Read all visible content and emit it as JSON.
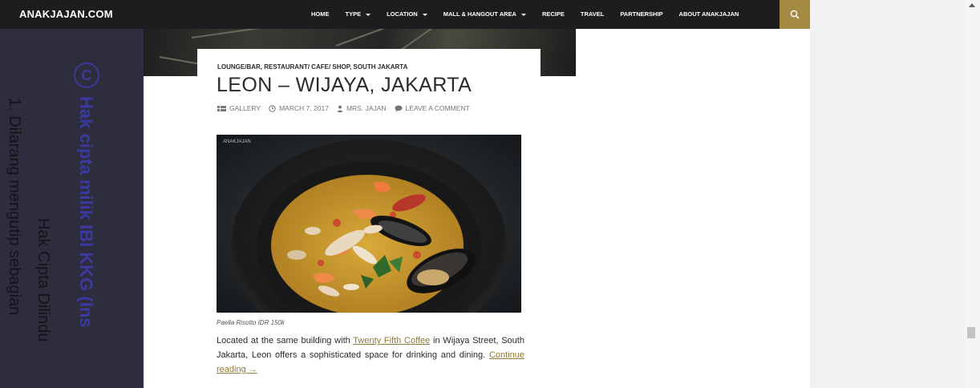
{
  "header": {
    "site_title": "ANAKJAJAN.COM",
    "nav": [
      {
        "label": "HOME",
        "has_caret": false
      },
      {
        "label": "TYPE",
        "has_caret": true
      },
      {
        "label": "LOCATION",
        "has_caret": true
      },
      {
        "label": "MALL & HANGOUT AREA",
        "has_caret": true
      },
      {
        "label": "RECIPE",
        "has_caret": false
      },
      {
        "label": "TRAVEL",
        "has_caret": false
      },
      {
        "label": "PARTNERSHIP",
        "has_caret": false
      },
      {
        "label": "ABOUT ANAKJAJAN",
        "has_caret": false
      }
    ],
    "search_icon": "search-icon"
  },
  "watermark": {
    "symbol": "C",
    "line1": "Hak cipta milik IBI KKG (Ins",
    "line2": "Hak Cipta Dilindu",
    "line3": "1. Dilarang mengutip sebagian"
  },
  "post": {
    "categories": "LOUNGE/BAR, RESTAURANT/ CAFE/ SHOP, SOUTH JAKARTA",
    "title": "LEON – WIJAYA, JAKARTA",
    "meta": {
      "format": "GALLERY",
      "date": "MARCH 7, 2017",
      "author": "MRS. JAJAN",
      "comments": "LEAVE A COMMENT"
    },
    "image_watermark": "ANAKJAJAN",
    "caption": "Paella Risotto IDR 150k",
    "excerpt": {
      "part1": "Located at the same building with ",
      "link": "Twenty Fifth Coffee",
      "part2": " in Wijaya Street, South Jakarta, Leon offers a sophisticated space for drinking and dining. ",
      "continue": "Continue reading →"
    }
  },
  "colors": {
    "navbar": "#1d1d1f",
    "accent": "#a48a43",
    "sidebar": "#2d2d3d",
    "link": "#8f7a37"
  }
}
